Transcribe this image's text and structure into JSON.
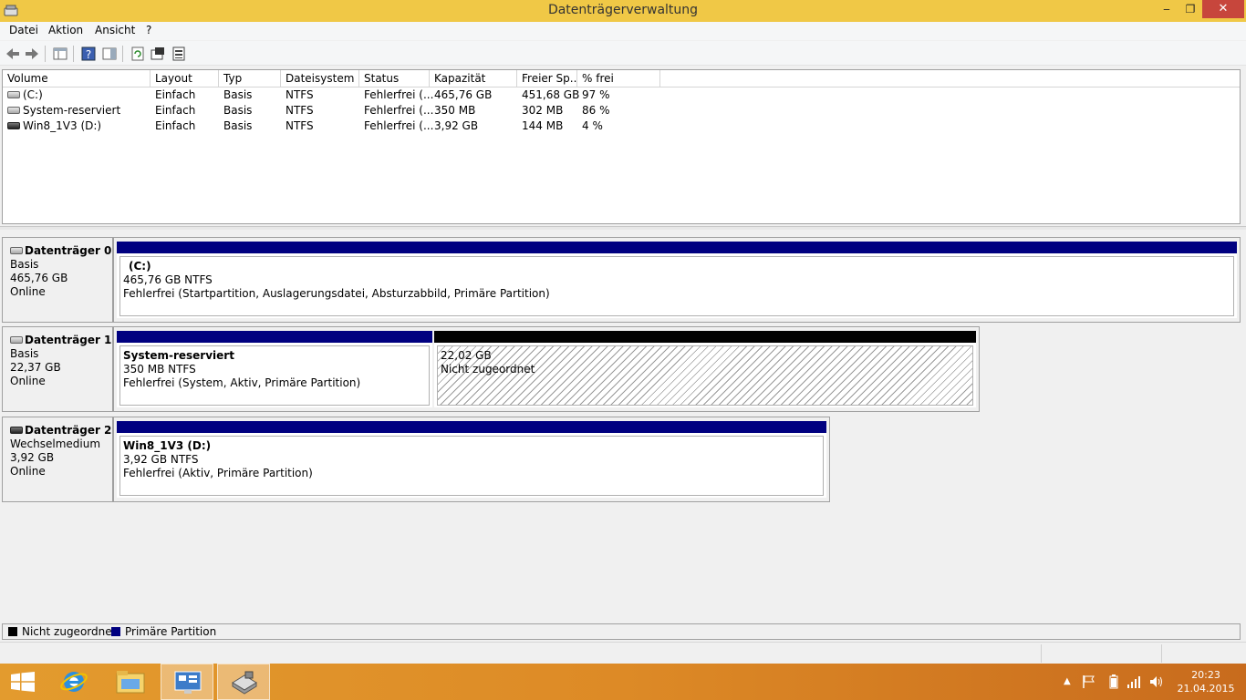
{
  "window": {
    "title": "Datenträgerverwaltung",
    "minimize": "‒",
    "maximize": "❐",
    "close": "✕"
  },
  "menu": [
    "Datei",
    "Aktion",
    "Ansicht",
    "?"
  ],
  "toolbar": [
    "back-icon",
    "forward-icon",
    "console-tree-icon",
    "help-icon",
    "show-hide-icon",
    "refresh-icon",
    "properties-icon",
    "disk-settings-icon"
  ],
  "volume_list": {
    "columns": [
      "Volume",
      "Layout",
      "Typ",
      "Dateisystem",
      "Status",
      "Kapazität",
      "Freier Sp...",
      "% frei"
    ],
    "rows": [
      {
        "volume": "(C:)",
        "layout": "Einfach",
        "typ": "Basis",
        "fs": "NTFS",
        "status": "Fehlerfrei (...",
        "kap": "465,76 GB",
        "frei": "451,68 GB",
        "pct": "97 %"
      },
      {
        "volume": "System-reserviert",
        "layout": "Einfach",
        "typ": "Basis",
        "fs": "NTFS",
        "status": "Fehlerfrei (...",
        "kap": "350 MB",
        "frei": "302 MB",
        "pct": "86 %"
      },
      {
        "volume": "Win8_1V3 (D:)",
        "layout": "Einfach",
        "typ": "Basis",
        "fs": "NTFS",
        "status": "Fehlerfrei (...",
        "kap": "3,92 GB",
        "frei": "144 MB",
        "pct": "4 %"
      }
    ]
  },
  "disks": [
    {
      "name": "Datenträger 0",
      "type": "Basis",
      "size": "465,76 GB",
      "state": "Online",
      "partitions": [
        {
          "name": "(C:)",
          "size_fs": "465,76 GB NTFS",
          "status": "Fehlerfrei (Startpartition, Auslagerungsdatei, Absturzabbild, Primäre Partition)"
        }
      ]
    },
    {
      "name": "Datenträger 1",
      "type": "Basis",
      "size": "22,37 GB",
      "state": "Online",
      "partitions": [
        {
          "name": "System-reserviert",
          "size_fs": "350 MB NTFS",
          "status": "Fehlerfrei (System, Aktiv, Primäre Partition)"
        },
        {
          "name": "",
          "size_fs": "22,02 GB",
          "status": "Nicht zugeordnet"
        }
      ]
    },
    {
      "name": "Datenträger 2",
      "type": "Wechselmedium",
      "size": "3,92 GB",
      "state": "Online",
      "partitions": [
        {
          "name": "Win8_1V3  (D:)",
          "size_fs": "3,92 GB NTFS",
          "status": "Fehlerfrei (Aktiv, Primäre Partition)"
        }
      ]
    }
  ],
  "legend": [
    {
      "label": "Nicht zugeordnet",
      "color": "#000000"
    },
    {
      "label": "Primäre Partition",
      "color": "#000080"
    }
  ],
  "taskbar": {
    "items": [
      "start-icon",
      "internet-explorer-icon",
      "file-explorer-icon",
      "control-panel-icon",
      "disk-management-icon"
    ],
    "clock": {
      "time": "20:23",
      "date": "21.04.2015"
    }
  },
  "colors": {
    "titlebar": "#f0c846",
    "primary_partition": "#000080",
    "unallocated": "#000000",
    "close": "#c7463c"
  }
}
